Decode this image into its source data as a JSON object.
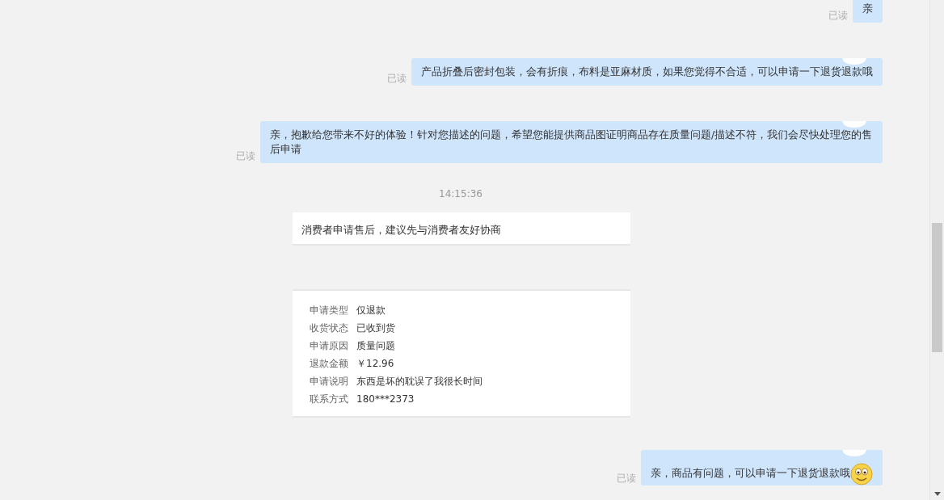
{
  "messages": [
    {
      "kind": "message",
      "text": "亲",
      "read_status": "已读",
      "emoji": false
    },
    {
      "kind": "message",
      "text": "产品折叠后密封包装，会有折痕，布料是亚麻材质，如果您觉得不合适，可以申请一下退货退款哦",
      "read_status": "已读",
      "emoji": false
    },
    {
      "kind": "message",
      "text": "亲，抱歉给您带来不好的体验！针对您描述的问题，希望您能提供商品图证明商品存在质量问题/描述不符，我们会尽快处理您的售后申请",
      "read_status": "已读",
      "emoji": false
    },
    {
      "kind": "time",
      "text": "14:15:36"
    },
    {
      "kind": "notice",
      "text": "消费者申请售后，建议先与消费者友好协商"
    },
    {
      "kind": "details",
      "rows": [
        {
          "label": "申请类型",
          "value": "仅退款"
        },
        {
          "label": "收货状态",
          "value": "已收到货"
        },
        {
          "label": "申请原因",
          "value": "质量问题"
        },
        {
          "label": "退款金额",
          "value": "￥12.96"
        },
        {
          "label": "申请说明",
          "value": "东西是坏的耽误了我很长时间"
        },
        {
          "label": "联系方式",
          "value": "180***2373"
        }
      ]
    },
    {
      "kind": "message",
      "text": "亲，商品有问题，可以申请一下退货退款哦",
      "read_status": "已读",
      "emoji": true
    }
  ]
}
